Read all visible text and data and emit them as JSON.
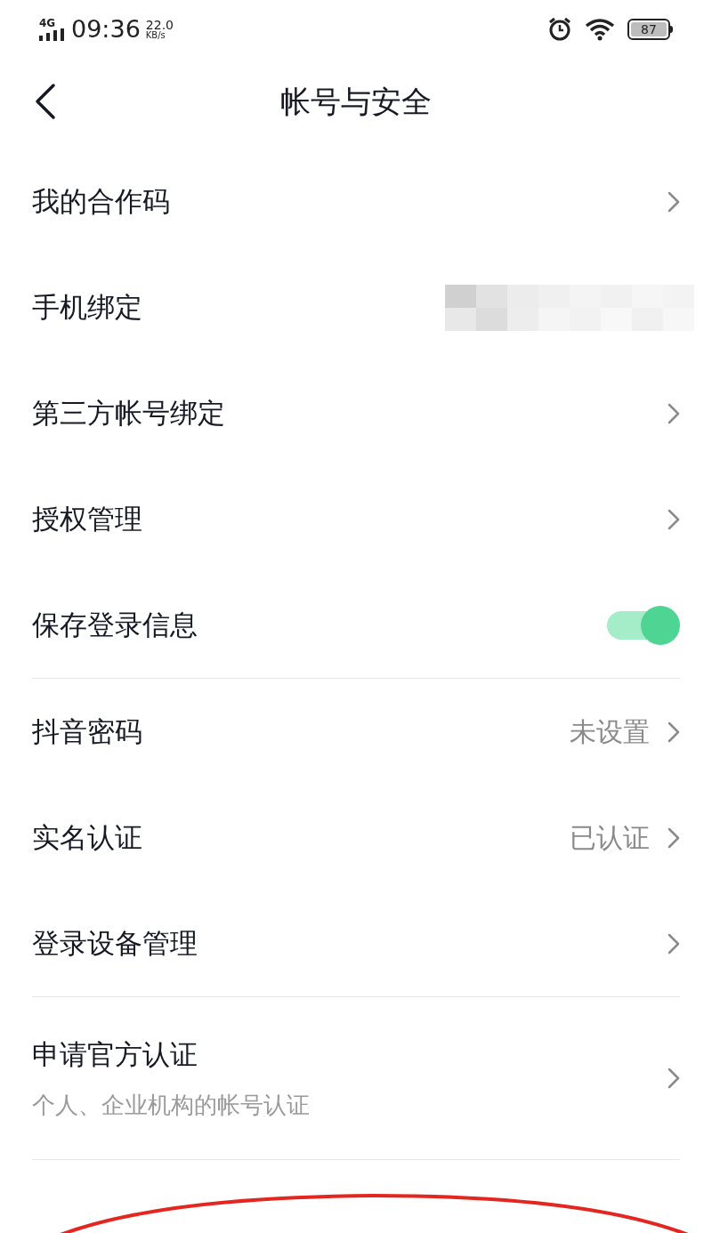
{
  "status_bar": {
    "network": "4G",
    "time": "09:36",
    "speed": "22.0",
    "speed_unit": "KB/s",
    "battery": "87"
  },
  "header": {
    "title": "帐号与安全"
  },
  "sections": [
    {
      "items": [
        {
          "kind": "link",
          "label": "我的合作码"
        },
        {
          "kind": "masked",
          "label": "手机绑定"
        },
        {
          "kind": "link",
          "label": "第三方帐号绑定"
        },
        {
          "kind": "link",
          "label": "授权管理"
        },
        {
          "kind": "toggle",
          "label": "保存登录信息",
          "on": true
        }
      ]
    },
    {
      "items": [
        {
          "kind": "link",
          "label": "抖音密码",
          "value": "未设置"
        },
        {
          "kind": "link",
          "label": "实名认证",
          "value": "已认证"
        },
        {
          "kind": "link",
          "label": "登录设备管理"
        }
      ]
    },
    {
      "items": [
        {
          "kind": "link",
          "label": "申请官方认证",
          "description": "个人、企业机构的帐号认证"
        }
      ]
    }
  ]
}
